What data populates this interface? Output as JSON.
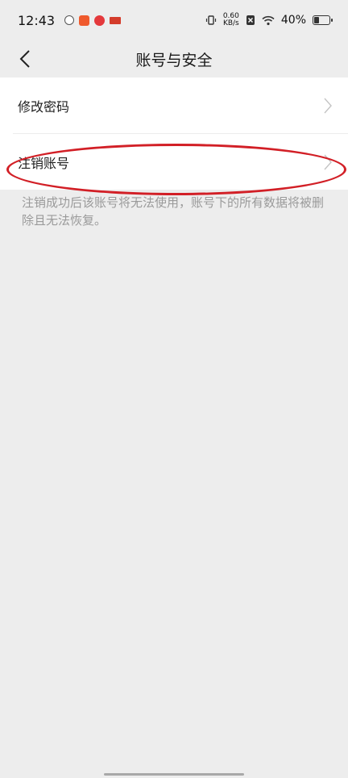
{
  "status_bar": {
    "time": "12:43",
    "net_speed_value": "0.60",
    "net_speed_unit": "KB/s",
    "battery_pct": "40%"
  },
  "nav": {
    "title": "账号与安全"
  },
  "settings": {
    "items": [
      {
        "label": "修改密码"
      },
      {
        "label": "注销账号"
      }
    ],
    "cancel_hint": "注销成功后该账号将无法使用，账号下的所有数据将被删除且无法恢复。"
  },
  "colors": {
    "highlight": "#d21f26",
    "page_bg": "#ededed"
  }
}
